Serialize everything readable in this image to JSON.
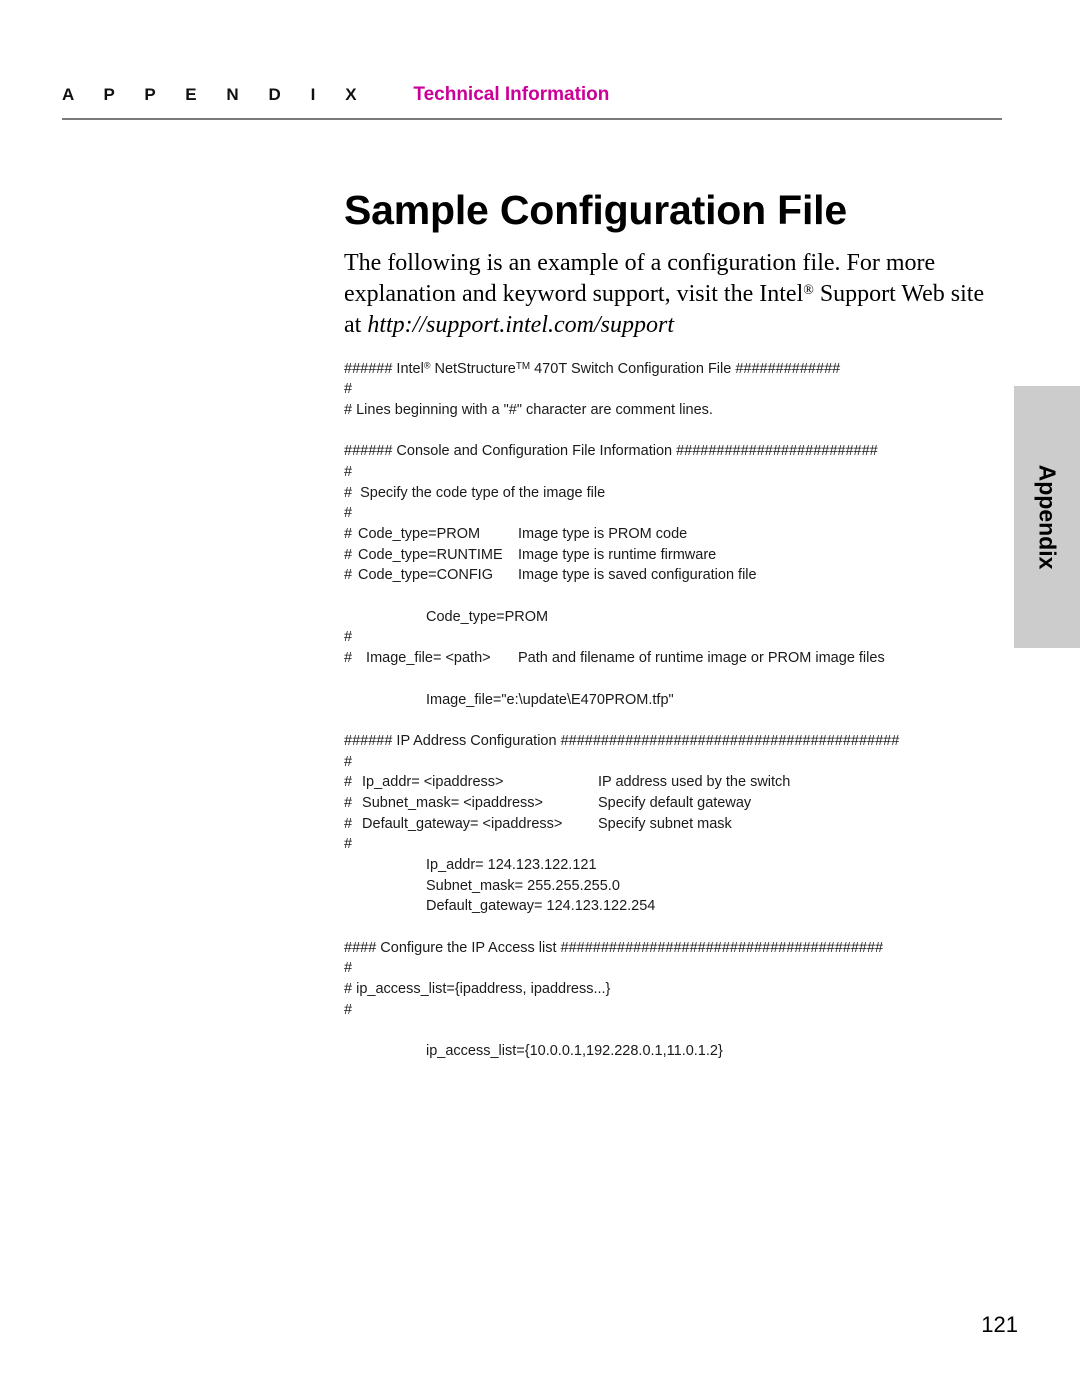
{
  "header": {
    "appendix_word": "A  P  P  E  N  D  I  X",
    "section_title": "Technical Information"
  },
  "title": "Sample Configuration File",
  "intro": {
    "part1": "The following is an example of a configuration file. For more explanation and keyword support, visit the Intel",
    "registered": "®",
    "part2": " Support Web site at ",
    "url": "http://support.intel.com/support"
  },
  "thumb_tab": {
    "label": "Appendix",
    "color": "#cccccc"
  },
  "code": {
    "lines": [
      {
        "id": "l1",
        "type": "banner",
        "hashes_lead": "######",
        "text": " Intel",
        "reg": "®",
        "text2": " NetStructure",
        "tm": "TM",
        "text3": " 470T Switch Configuration File ",
        "hashes_trail": "#############"
      },
      {
        "id": "l2",
        "type": "plain",
        "text": "#"
      },
      {
        "id": "l3",
        "type": "plain",
        "text": "# Lines beginning with a \"#\" character are comment lines."
      },
      {
        "id": "l4",
        "type": "blank",
        "text": ""
      },
      {
        "id": "l5",
        "type": "plain",
        "text": "###### Console and Configuration File Information #########################"
      },
      {
        "id": "l6",
        "type": "plain",
        "text": "#"
      },
      {
        "id": "l7",
        "type": "plain",
        "text": "#  Specify the code type of the image file"
      },
      {
        "id": "l8",
        "type": "plain",
        "text": "#"
      },
      {
        "id": "l9",
        "type": "cols",
        "hash": "#",
        "key": "Code_type=PROM",
        "desc": "Image type is PROM code",
        "keywidth": "w-key1"
      },
      {
        "id": "l10",
        "type": "cols",
        "hash": "#",
        "key": "Code_type=RUNTIME",
        "desc": "Image type is runtime firmware",
        "keywidth": "w-key1"
      },
      {
        "id": "l11",
        "type": "cols",
        "hash": "#",
        "key": "Code_type=CONFIG",
        "desc": "Image type is saved configuration file",
        "keywidth": "w-key1"
      },
      {
        "id": "l12",
        "type": "blank",
        "text": ""
      },
      {
        "id": "l13",
        "type": "indent",
        "text": "Code_type=PROM"
      },
      {
        "id": "l14",
        "type": "plain",
        "text": "#"
      },
      {
        "id": "l15",
        "type": "cols",
        "hash": "#",
        "key": "  Image_file= <path>",
        "desc": "Path and filename of runtime image or PROM image files",
        "keywidth": "w-key1"
      },
      {
        "id": "l16",
        "type": "blank",
        "text": ""
      },
      {
        "id": "l17",
        "type": "indent",
        "text": "Image_file=\"e:\\update\\E470PROM.tfp\""
      },
      {
        "id": "l18",
        "type": "blank",
        "text": ""
      },
      {
        "id": "l19",
        "type": "plain",
        "text": "###### IP Address Configuration ##########################################"
      },
      {
        "id": "l20",
        "type": "plain",
        "text": "#"
      },
      {
        "id": "l21",
        "type": "cols",
        "hash": "#",
        "key": " Ip_addr= <ipaddress>",
        "desc": "IP address used by the switch",
        "keywidth": "w-key2"
      },
      {
        "id": "l22",
        "type": "cols",
        "hash": "#",
        "key": " Subnet_mask= <ipaddress>",
        "desc": "Specify default gateway",
        "keywidth": "w-key2"
      },
      {
        "id": "l23",
        "type": "cols",
        "hash": "#",
        "key": " Default_gateway= <ipaddress>",
        "desc": "Specify subnet mask",
        "keywidth": "w-key2"
      },
      {
        "id": "l24",
        "type": "plain",
        "text": "#"
      },
      {
        "id": "l25",
        "type": "indent",
        "text": "Ip_addr= 124.123.122.121"
      },
      {
        "id": "l26",
        "type": "indent",
        "text": "Subnet_mask= 255.255.255.0"
      },
      {
        "id": "l27",
        "type": "indent",
        "text": "Default_gateway= 124.123.122.254"
      },
      {
        "id": "l28",
        "type": "blank",
        "text": ""
      },
      {
        "id": "l29",
        "type": "plain",
        "text": "#### Configure the IP Access list ########################################"
      },
      {
        "id": "l30",
        "type": "plain",
        "text": "#"
      },
      {
        "id": "l31",
        "type": "plain",
        "text": "# ip_access_list={ipaddress, ipaddress...}"
      },
      {
        "id": "l32",
        "type": "plain",
        "text": "#"
      },
      {
        "id": "l33",
        "type": "blank",
        "text": ""
      },
      {
        "id": "l34",
        "type": "indent",
        "text": "ip_access_list={10.0.0.1,192.228.0.1,11.0.1.2}"
      }
    ]
  },
  "folio": "121"
}
